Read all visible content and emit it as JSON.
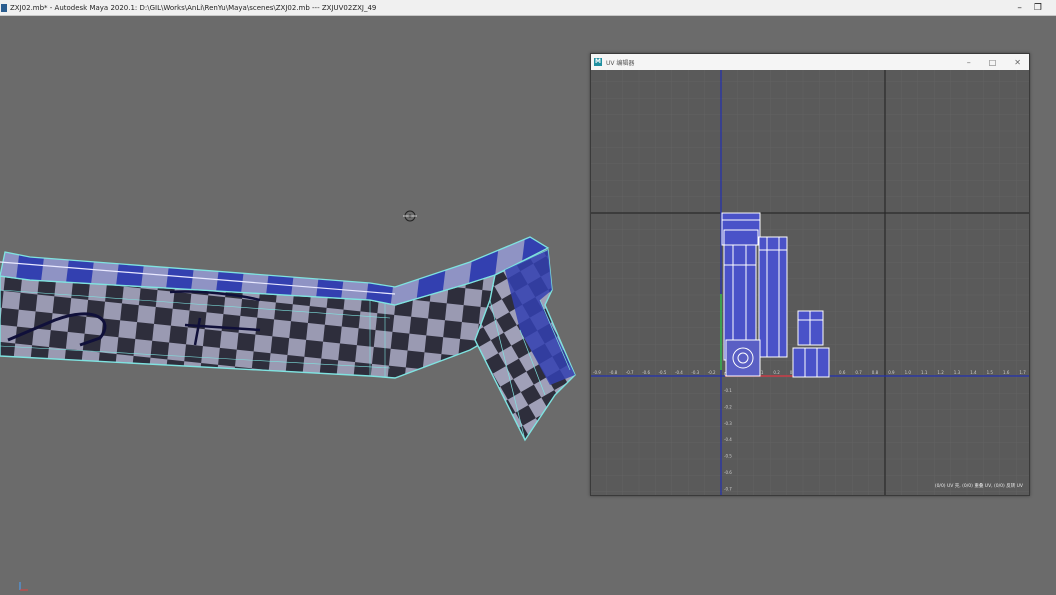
{
  "window": {
    "title": "ZXJ02.mb* - Autodesk Maya 2020.1: D:\\GIL\\Works\\AnLi\\RenYu\\Maya\\scenes\\ZXJ02.mb  ---  ZXJUV02ZXJ_49",
    "minimize_glyph": "–",
    "restore_glyph": "❐"
  },
  "uv_editor": {
    "title": "UV 编辑器",
    "logo_letter": "M",
    "minimize_glyph": "–",
    "maximize_glyph": "□",
    "close_glyph": "✕",
    "status": "(0/0) UV 壳, (0/0) 重叠 UV, (0/0) 反转 UV",
    "vertical_ticks": [
      "0.9",
      "0.8",
      "0.7",
      "0.6",
      "0.5",
      "0.4",
      "0.3",
      "0.2",
      "0.1",
      "0.0",
      "-0.1",
      "-0.2",
      "-0.3",
      "-0.4",
      "-0.5",
      "-0.6",
      "-0.7"
    ],
    "horizontal_ticks": [
      "-0.9",
      "-0.8",
      "-0.7",
      "-0.6",
      "-0.5",
      "-0.4",
      "-0.3",
      "-0.2",
      "-0.1",
      "0.0",
      "0.1",
      "0.2",
      "0.3",
      "0.4",
      "0.5",
      "0.6",
      "0.7",
      "0.8",
      "0.9",
      "1.0",
      "1.1",
      "1.2",
      "1.3",
      "1.4",
      "1.5",
      "1.6",
      "1.7",
      "1.8"
    ]
  },
  "colors": {
    "viewport_bg": "#6b6b6b",
    "uv_bg": "#5a5a5a",
    "checker_dark": "#2e2e3c",
    "checker_light": "#9a9ab2",
    "checker_blue": "#3948b8",
    "wire": "#7fe3e0",
    "uv_axis": "#2230b0",
    "uv_shell": "#4a52c8"
  }
}
